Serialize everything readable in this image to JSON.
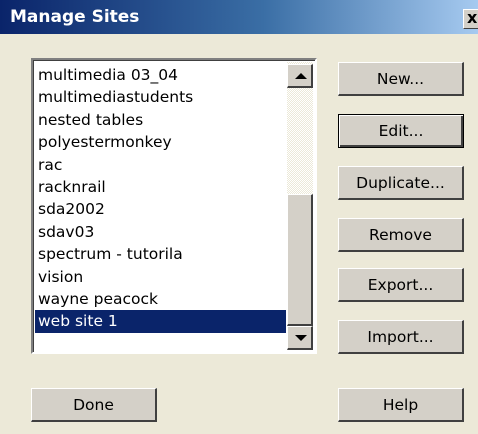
{
  "window": {
    "title": "Manage Sites",
    "close_glyph": "x"
  },
  "sites": [
    "multimedia 03_04",
    "multimediastudents",
    "nested tables",
    "polyestermonkey",
    "rac",
    "racknrail",
    "sda2002",
    "sdav03",
    "spectrum - tutorila",
    "vision",
    "wayne peacock",
    "web site 1"
  ],
  "selected_site": "web site 1",
  "buttons": {
    "new": "New...",
    "edit": "Edit...",
    "duplicate": "Duplicate...",
    "remove": "Remove",
    "export": "Export...",
    "import": "Import...",
    "done": "Done",
    "help": "Help"
  },
  "icons": {
    "close": "close-icon",
    "scroll_up": "chevron-up-icon",
    "scroll_down": "chevron-down-icon"
  },
  "colors": {
    "titlebar_start": "#0a246a",
    "titlebar_end": "#a6caf0",
    "selection": "#0a246a",
    "face": "#ece9d8"
  }
}
